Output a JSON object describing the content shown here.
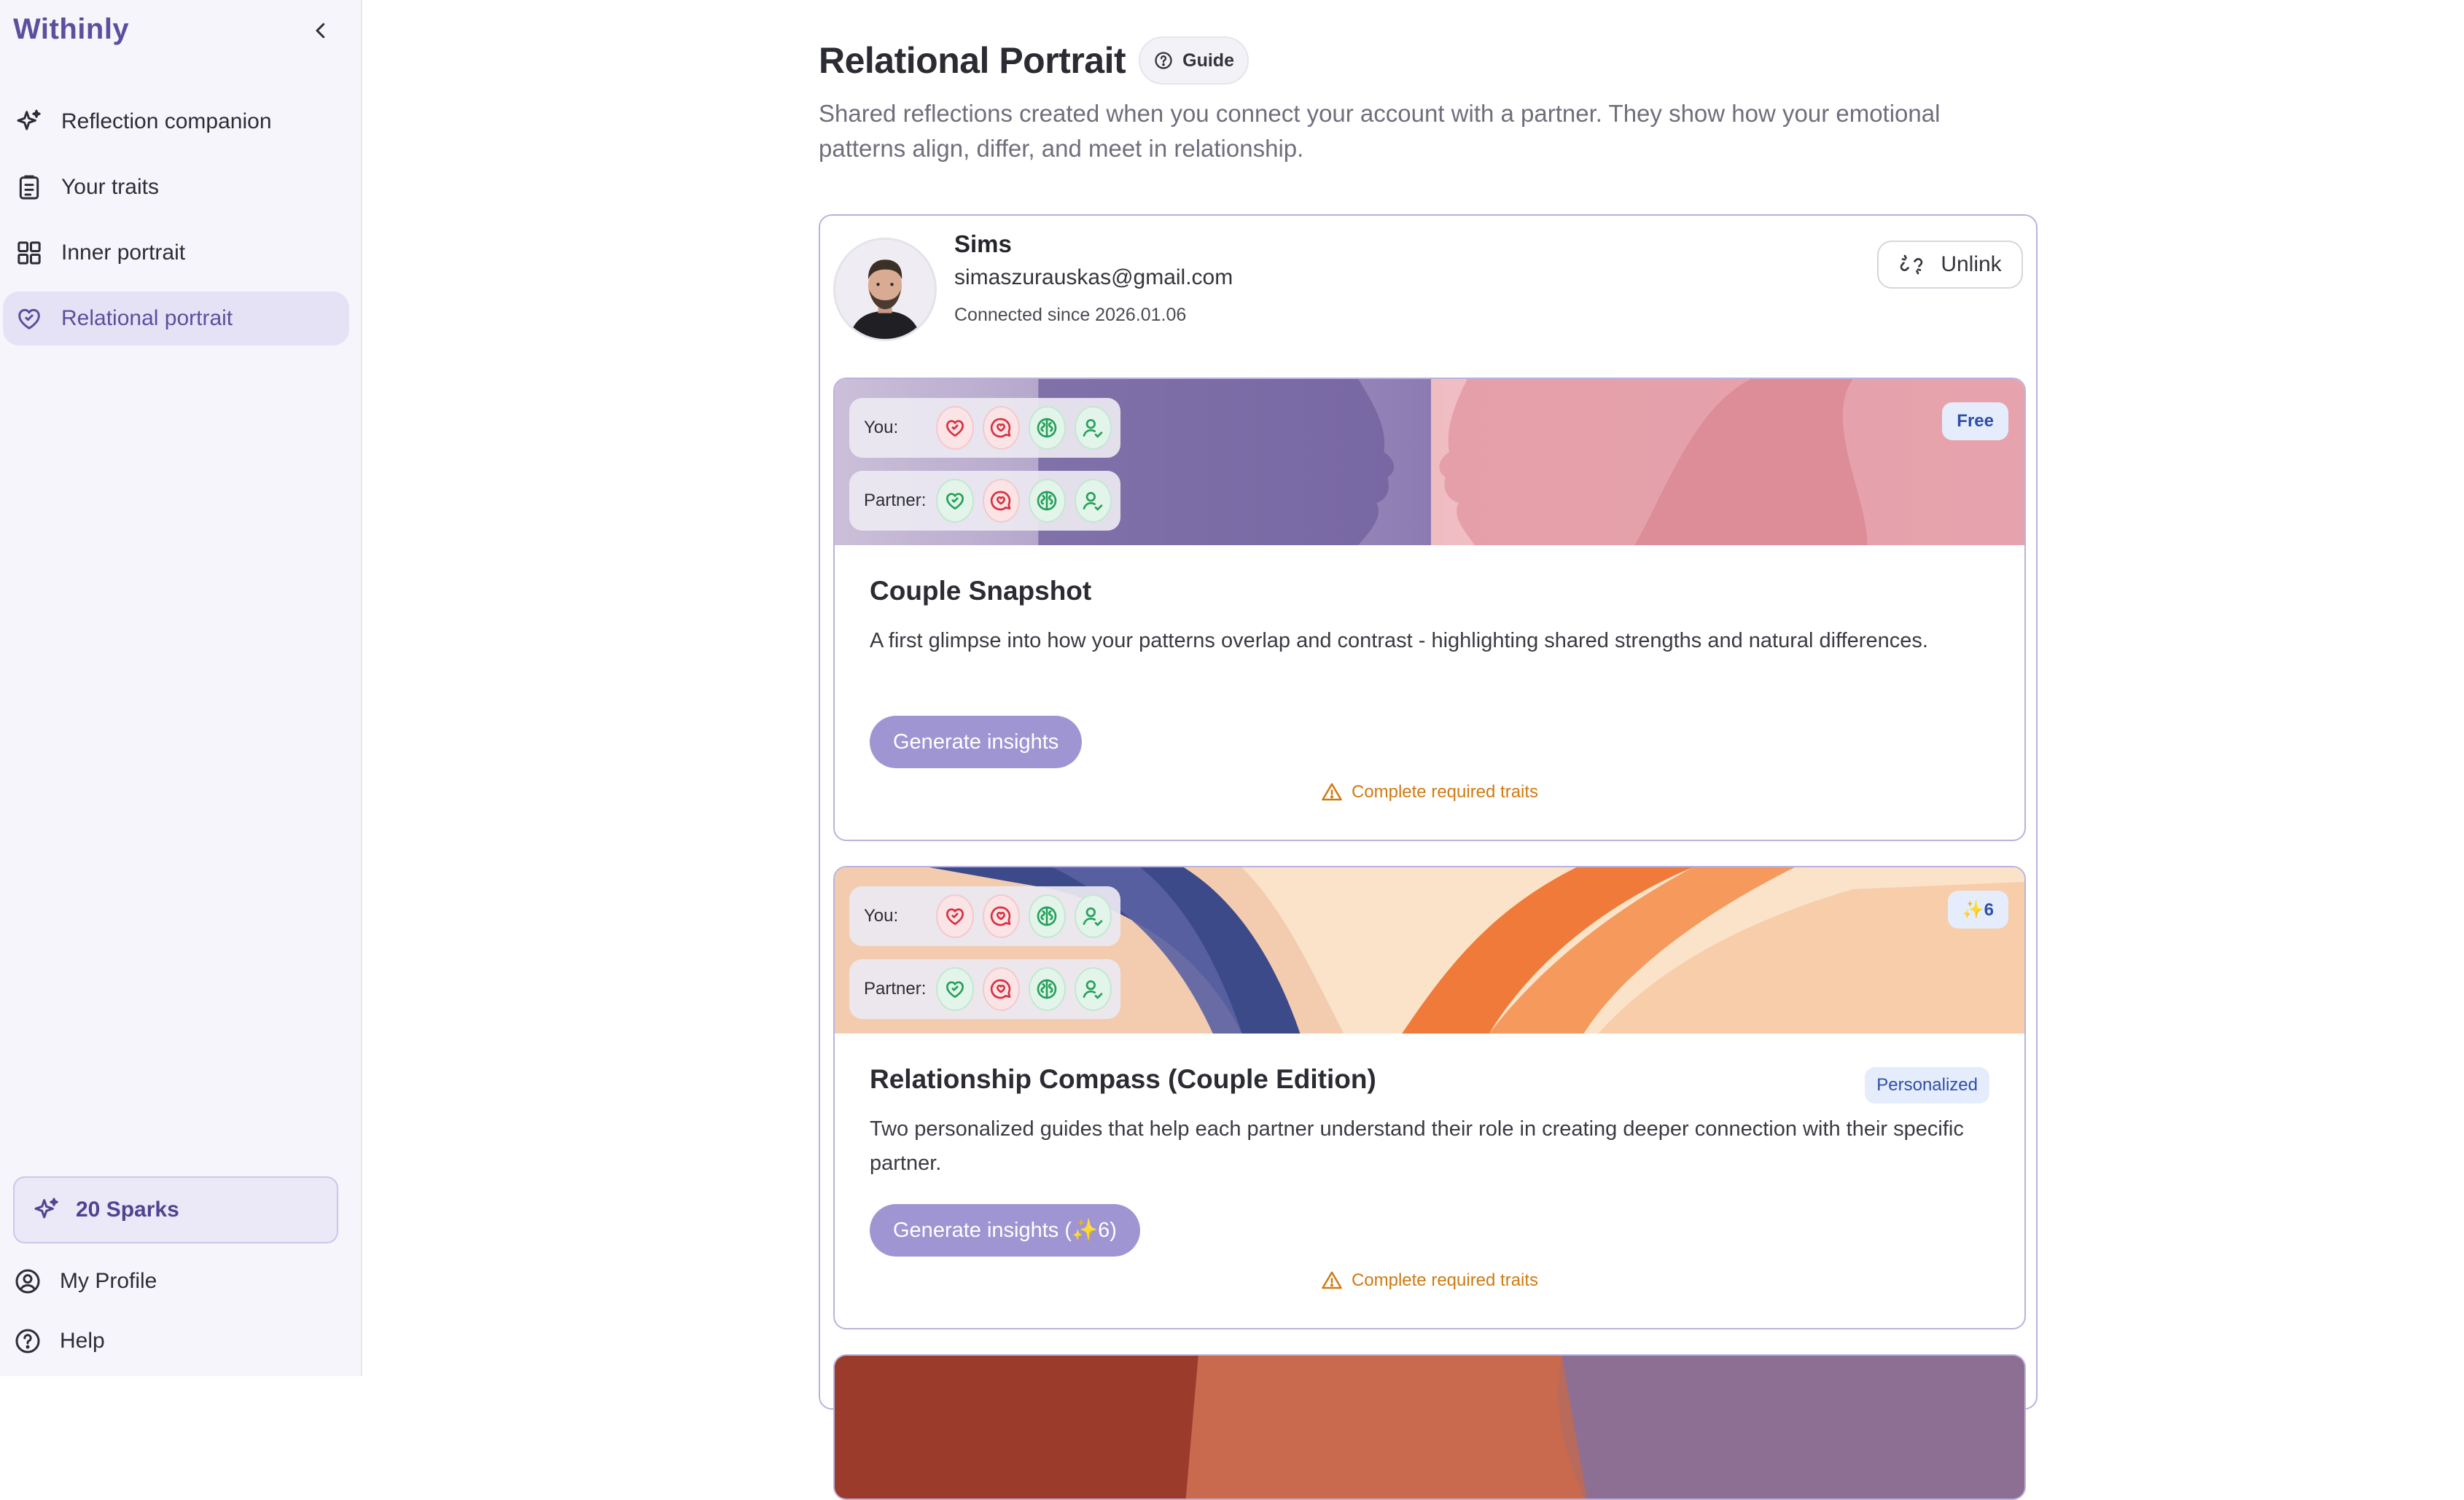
{
  "app": {
    "brand": "Withinly"
  },
  "sidebar": {
    "items": [
      {
        "label": "Reflection companion",
        "icon": "sparkles-icon",
        "active": false
      },
      {
        "label": "Your traits",
        "icon": "clipboard-icon",
        "active": false
      },
      {
        "label": "Inner portrait",
        "icon": "grid-icon",
        "active": false
      },
      {
        "label": "Relational portrait",
        "icon": "hearts-icon",
        "active": true
      }
    ],
    "sparks_label": "20 Sparks",
    "profile_label": "My Profile",
    "help_label": "Help"
  },
  "page": {
    "title": "Relational Portrait",
    "guide_label": "Guide",
    "subtitle": "Shared reflections created when you connect your account with a partner. They show how your emotional patterns align, differ, and meet in relationship."
  },
  "partner": {
    "name": "Sims",
    "email": "simaszurauskas@gmail.com",
    "since": "Connected since 2026.01.06",
    "unlink_label": "Unlink"
  },
  "cards": [
    {
      "you_label": "You:",
      "partner_label": "Partner:",
      "tag": "Free",
      "title": "Couple Snapshot",
      "description": "A first glimpse into how your patterns overlap and contrast - highlighting shared strengths and natural differences.",
      "button": "Generate insights",
      "warning": "Complete required traits",
      "you_traits": [
        "red",
        "red",
        "green",
        "green"
      ],
      "partner_traits": [
        "green",
        "red",
        "green",
        "green"
      ]
    },
    {
      "you_label": "You:",
      "partner_label": "Partner:",
      "tag": "✨6",
      "title": "Relationship Compass (Couple Edition)",
      "personalized": "Personalized",
      "description": "Two personalized guides that help each partner understand their role in creating deeper connection with their specific partner.",
      "button": "Generate insights (✨6)",
      "warning": "Complete required traits",
      "you_traits": [
        "red",
        "red",
        "green",
        "green"
      ],
      "partner_traits": [
        "green",
        "red",
        "green",
        "green"
      ]
    }
  ],
  "colors": {
    "accent": "#5b4f9e",
    "button": "#9f95d2",
    "warning": "#d07a10",
    "trait_red": "#d9303f",
    "trait_green": "#25a05a"
  }
}
